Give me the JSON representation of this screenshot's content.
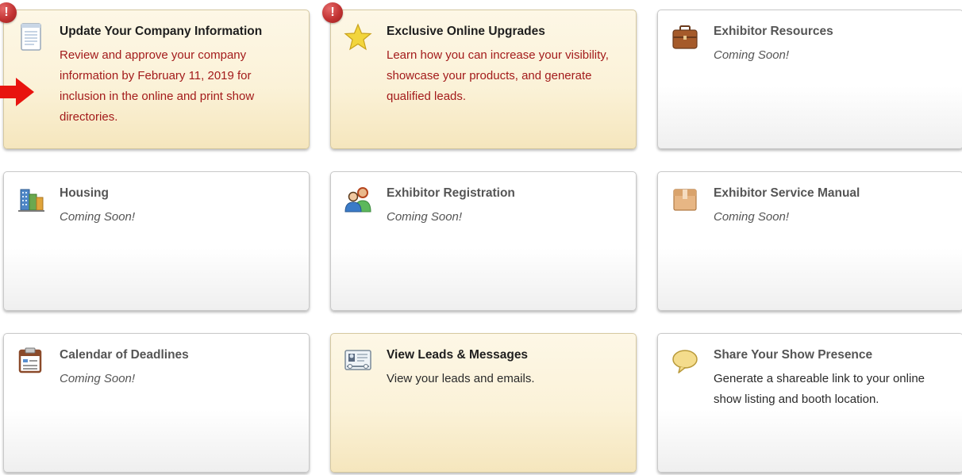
{
  "colors": {
    "highlight_bg": "#fbf2d8",
    "red_text": "#a31b1b",
    "alert_red": "#c23333"
  },
  "cards": [
    {
      "title": "Update Your Company Information",
      "body": "Review and approve your company information by February 11, 2019 for inclusion in the online and print show directories.",
      "icon": "document-icon",
      "alert": "!",
      "highlighted": true
    },
    {
      "title": "Exclusive Online Upgrades",
      "body": "Learn how you can increase your visibility, showcase your products, and generate qualified leads.",
      "icon": "star-icon",
      "alert": "!",
      "highlighted": true
    },
    {
      "title": "Exhibitor Resources",
      "body": "Coming Soon!",
      "icon": "briefcase-icon",
      "highlighted": false
    },
    {
      "title": "Housing",
      "body": "Coming Soon!",
      "icon": "buildings-icon",
      "highlighted": false
    },
    {
      "title": "Exhibitor Registration",
      "body": "Coming Soon!",
      "icon": "people-icon",
      "highlighted": false
    },
    {
      "title": "Exhibitor Service Manual",
      "body": "Coming Soon!",
      "icon": "box-icon",
      "highlighted": false
    },
    {
      "title": "Calendar of Deadlines",
      "body": "Coming Soon!",
      "icon": "calendar-icon",
      "highlighted": false
    },
    {
      "title": "View Leads & Messages",
      "body": "View your leads and emails.",
      "icon": "badge-scanner-icon",
      "highlighted": true
    },
    {
      "title": "Share Your Show Presence",
      "body": "Generate a shareable link to your online show listing and booth location.",
      "icon": "speech-bubble-icon",
      "highlighted": false
    }
  ]
}
